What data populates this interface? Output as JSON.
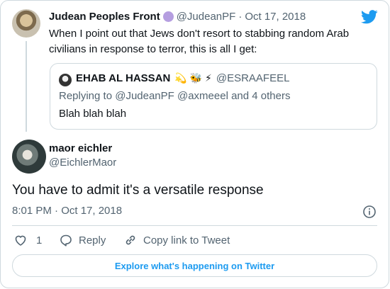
{
  "colors": {
    "accent": "#1d9bf0",
    "muted": "#536471",
    "border": "#cfd9de",
    "badge": "#b59ee0"
  },
  "parent_tweet": {
    "display_name": "Judean Peoples Front",
    "handle": "@JudeanPF",
    "separator": "·",
    "date": "Oct 17, 2018",
    "text_line1": "When I point out that Jews don't resort to stabbing random Arab",
    "text_line2": "civilians in response to terror, this is all I get:"
  },
  "quoted_tweet": {
    "display_name": "EHAB AL HASSAN",
    "name_emojis": "💫 🐝 ⚡",
    "handle": "@ESRAAFEEL",
    "replying_to": "Replying to @JudeanPF @axmeeel and 4 others",
    "text": "Blah blah blah"
  },
  "main_tweet": {
    "display_name": "maor eichler",
    "handle": "@EichlerMaor",
    "text": "You have to admit it's a versatile response",
    "timestamp": "8:01 PM · Oct 17, 2018"
  },
  "actions": {
    "like_count": "1",
    "reply_label": "Reply",
    "copy_link_label": "Copy link to Tweet"
  },
  "explore_label": "Explore what's happening on Twitter",
  "icons": [
    "twitter-bird-icon",
    "heart-icon",
    "reply-icon",
    "link-icon",
    "info-icon"
  ]
}
